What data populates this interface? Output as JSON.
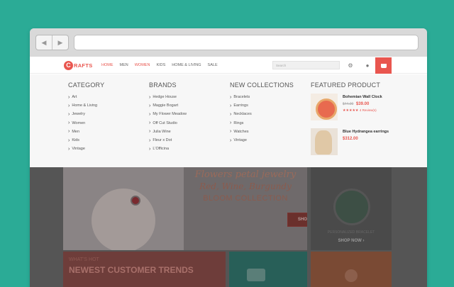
{
  "menu": [
    "HOME",
    "MEN",
    "WOMEN",
    "KIDS",
    "HOME & LIVING",
    "SALE"
  ],
  "logo_text": "RAFTS",
  "search_placeholder": "Search",
  "colors": {
    "accent": "#e9564f",
    "background": "#2bab96"
  },
  "columns": [
    {
      "title": "CATEGORY",
      "items": [
        "Art",
        "Home & Living",
        "Jewelry",
        "Women",
        "Men",
        "Kids",
        "Vintage"
      ]
    },
    {
      "title": "BRANDS",
      "items": [
        "Hedge House",
        "Maggie Bogart",
        "My Flower Meadow",
        "Off Cut Studio",
        "Julia Wine",
        "Fleur x Dot",
        "L'Officina"
      ]
    },
    {
      "title": "NEW COLLECTIONS",
      "items": [
        "Bracelets",
        "Earrings",
        "Necklaces",
        "Rings",
        "Watches",
        "Vintage"
      ]
    }
  ],
  "featured": {
    "title": "FEATURED PRODUCT",
    "products": [
      {
        "name": "Bohemian Wall Clock",
        "old_price": "$44.00",
        "price": "$39.00",
        "stars": "★★★★★",
        "reviews": "4 Review(s)"
      },
      {
        "name": "Blue Hydrangea earrings",
        "price": "$312.00"
      }
    ]
  },
  "hero": {
    "line1": "Flowers petal jewelry",
    "line2": "Red, Wine, Burgundy",
    "line3": "BLOOM COLLECTION",
    "button": "SHOP NOW"
  },
  "side_banner": {
    "label": "PERSONALIZED BRACELET",
    "button": "SHOP NOW ›"
  },
  "promo": {
    "small": "WHAT'S HOT",
    "big": "NEWEST CUSTOMER TRENDS"
  }
}
